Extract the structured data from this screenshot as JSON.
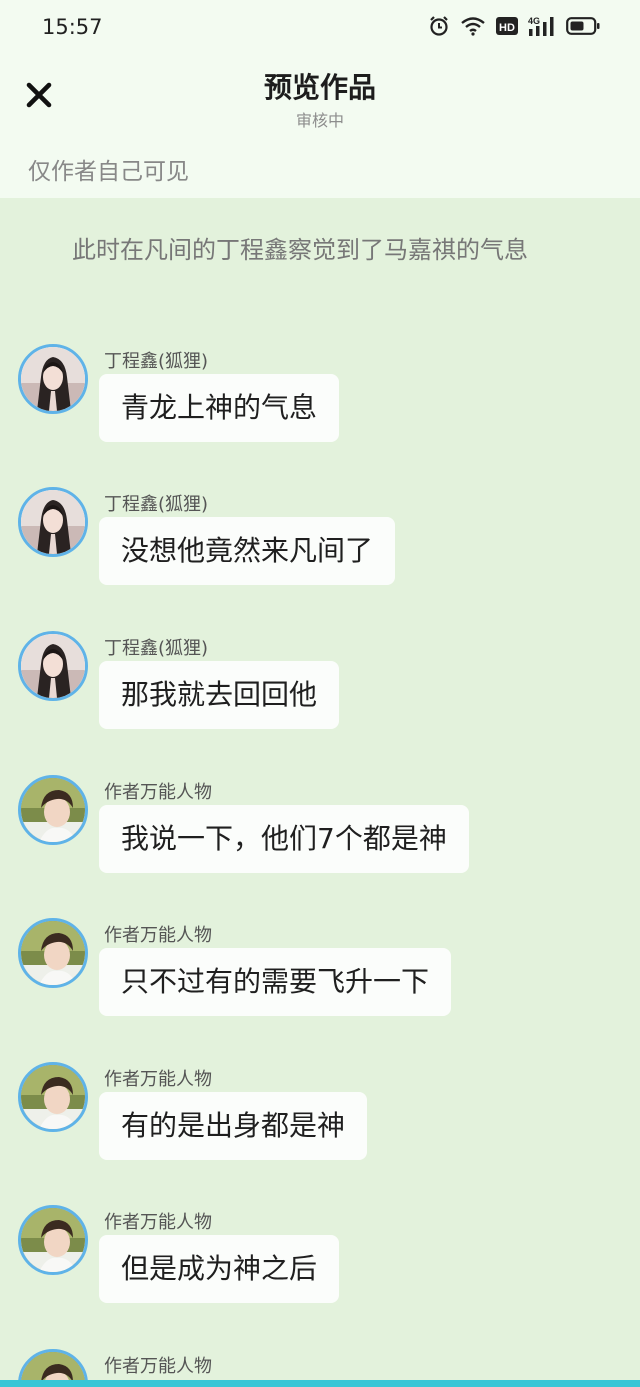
{
  "status_bar": {
    "time": "15:57",
    "icons": [
      "alarm-icon",
      "wifi-icon",
      "hd-icon",
      "signal-4g-icon",
      "battery-icon"
    ],
    "hd_label": "HD",
    "network_label": "4G"
  },
  "header": {
    "close_icon": "close-icon",
    "title": "预览作品",
    "subtitle": "审核中",
    "visibility_note": "仅作者自己可见"
  },
  "story": {
    "narration": "此时在凡间的丁程鑫察觉到了马嘉祺的气息",
    "messages": [
      {
        "sender": "丁程鑫(狐狸)",
        "text": "青龙上神的气息",
        "avatar": "long-hair-character"
      },
      {
        "sender": "丁程鑫(狐狸)",
        "text": "没想他竟然来凡间了",
        "avatar": "long-hair-character"
      },
      {
        "sender": "丁程鑫(狐狸)",
        "text": "那我就去回回他",
        "avatar": "long-hair-character"
      },
      {
        "sender": "作者万能人物",
        "text": "我说一下，他们7个都是神",
        "avatar": "author-photo"
      },
      {
        "sender": "作者万能人物",
        "text": "只不过有的需要飞升一下",
        "avatar": "author-photo"
      },
      {
        "sender": "作者万能人物",
        "text": "有的是出身都是神",
        "avatar": "author-photo"
      },
      {
        "sender": "作者万能人物",
        "text": "但是成为神之后",
        "avatar": "author-photo"
      },
      {
        "sender": "作者万能人物",
        "text": "",
        "avatar": "author-photo"
      }
    ]
  },
  "colors": {
    "page_background": "#e3f2dc",
    "header_background": "#f3fbf1",
    "bubble_background": "#fbfdfb",
    "avatar_border": "#5fb3e8",
    "bottom_strip": "#39c6d6"
  }
}
